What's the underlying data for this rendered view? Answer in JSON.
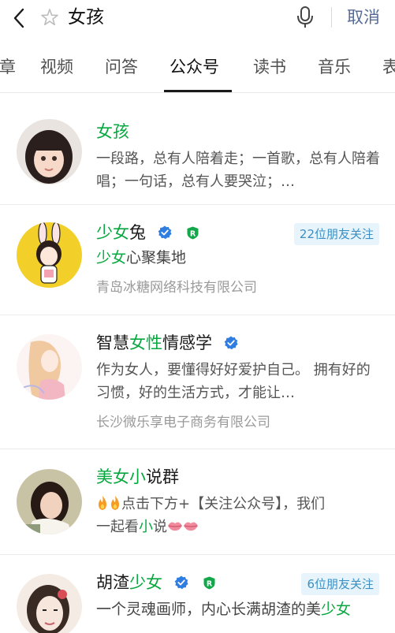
{
  "search": {
    "query": "女孩",
    "cancel_label": "取消"
  },
  "tabs": [
    {
      "label": "章"
    },
    {
      "label": "视频"
    },
    {
      "label": "问答"
    },
    {
      "label": "公众号",
      "active": true
    },
    {
      "label": "读书"
    },
    {
      "label": "音乐"
    },
    {
      "label": "表"
    }
  ],
  "results": [
    {
      "name": "女孩",
      "desc": "一段路，总有人陪着走；一首歌，总有人陪着唱；一句话，总有人要哭泣；…"
    },
    {
      "name_prefix": "少女",
      "name_suffix": "兔",
      "verified": true,
      "registered": true,
      "friends_label": "22位朋友关注",
      "slogan_prefix": "少女",
      "slogan_suffix": "心聚集地",
      "company": "青岛冰糖网络科技有限公司"
    },
    {
      "name_a": "智慧",
      "name_hl": "女性",
      "name_b": "情感学",
      "verified": true,
      "desc": "作为女人，要懂得好好爱护自己。 拥有好的习惯，好的生活方式，才能让…",
      "company": "长沙微乐享电子商务有限公司"
    },
    {
      "name_hl1": "美女",
      "name_hl2": "小",
      "name_b": "说群",
      "desc_line1": "点击下方+【关注公众号】，我们",
      "desc_line2_a": "一起看",
      "desc_line2_hl": "小",
      "desc_line2_b": "说"
    },
    {
      "name_a": "胡渣",
      "name_hl": "少女",
      "verified": true,
      "registered": true,
      "friends_label": "6位朋友关注",
      "desc_a": "一个灵魂画师，内心长满胡渣的美",
      "desc_hl": "少女"
    }
  ],
  "colors": {
    "highlight": "#07a83f",
    "link": "#576b95",
    "verify": "#2f7de1"
  }
}
